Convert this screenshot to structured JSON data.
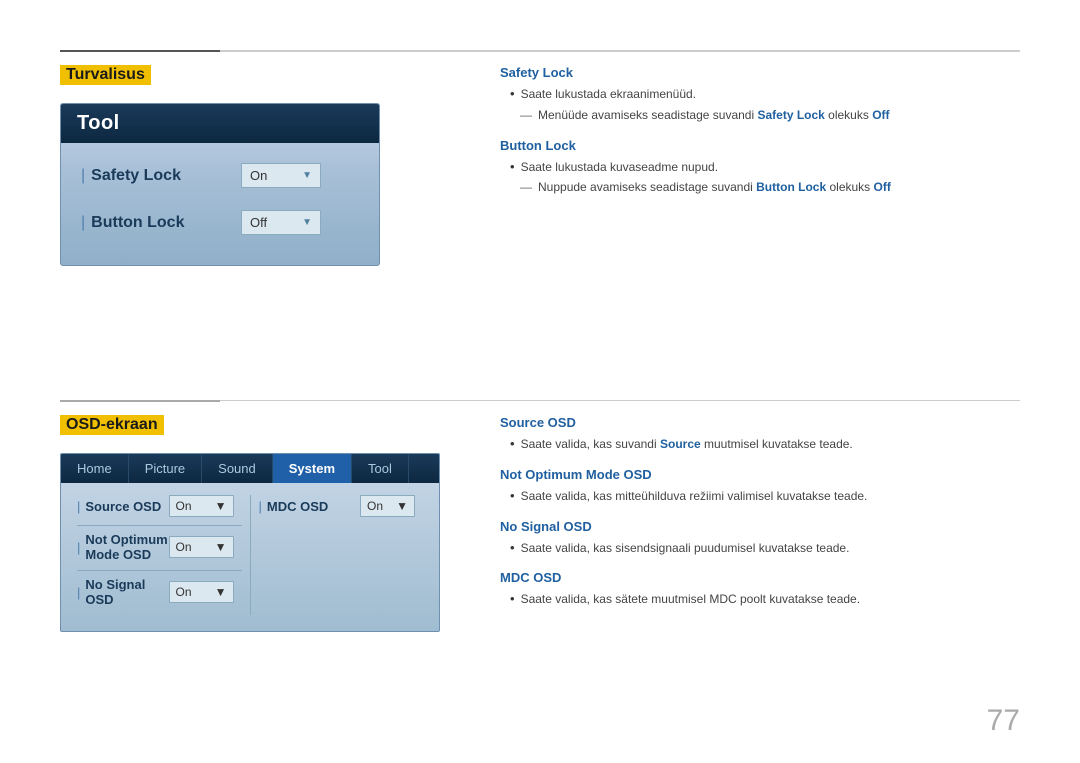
{
  "page": {
    "number": "77",
    "top_section": {
      "title": "Turvalisus",
      "tool_panel": {
        "header": "Tool",
        "rows": [
          {
            "label": "Safety Lock",
            "value": "On",
            "id": "safety-lock"
          },
          {
            "label": "Button Lock",
            "value": "Off",
            "id": "button-lock"
          }
        ]
      },
      "info": {
        "safety_lock": {
          "title": "Safety Lock",
          "bullet1": "Saate lukustada ekraanimenüüd.",
          "sub1_prefix": "Menüüde avamiseks seadistage suvandi ",
          "sub1_bold": "Safety Lock",
          "sub1_suffix": " olekuks ",
          "sub1_value": "Off"
        },
        "button_lock": {
          "title": "Button Lock",
          "bullet1": "Saate lukustada kuvaseadme nupud.",
          "sub1_prefix": "Nuppude avamiseks seadistage suvandi ",
          "sub1_bold": "Button Lock",
          "sub1_suffix": " olekuks ",
          "sub1_value": "Off"
        }
      }
    },
    "bottom_section": {
      "title": "OSD-ekraan",
      "osd_panel": {
        "tabs": [
          "Home",
          "Picture",
          "Sound",
          "System",
          "Tool"
        ],
        "active_tab": "System",
        "rows_left": [
          {
            "label": "Source OSD",
            "value": "On"
          },
          {
            "label": "Not Optimum Mode OSD",
            "value": "On"
          },
          {
            "label": "No Signal OSD",
            "value": "On"
          }
        ],
        "rows_right": [
          {
            "label": "MDC OSD",
            "value": "On"
          }
        ]
      },
      "info": {
        "source_osd": {
          "title": "Source OSD",
          "bullet1_prefix": "Saate valida, kas suvandi ",
          "bullet1_bold": "Source",
          "bullet1_suffix": " muutmisel kuvatakse teade."
        },
        "not_optimum": {
          "title": "Not Optimum Mode OSD",
          "bullet1": "Saate valida, kas mitteühilduva režiimi valimisel kuvatakse teade."
        },
        "no_signal": {
          "title": "No Signal OSD",
          "bullet1": "Saate valida, kas sisendsignaali puudumisel kuvatakse teade."
        },
        "mdc_osd": {
          "title": "MDC OSD",
          "bullet1": "Saate valida, kas sätete muutmisel MDC poolt kuvatakse teade."
        }
      }
    }
  }
}
